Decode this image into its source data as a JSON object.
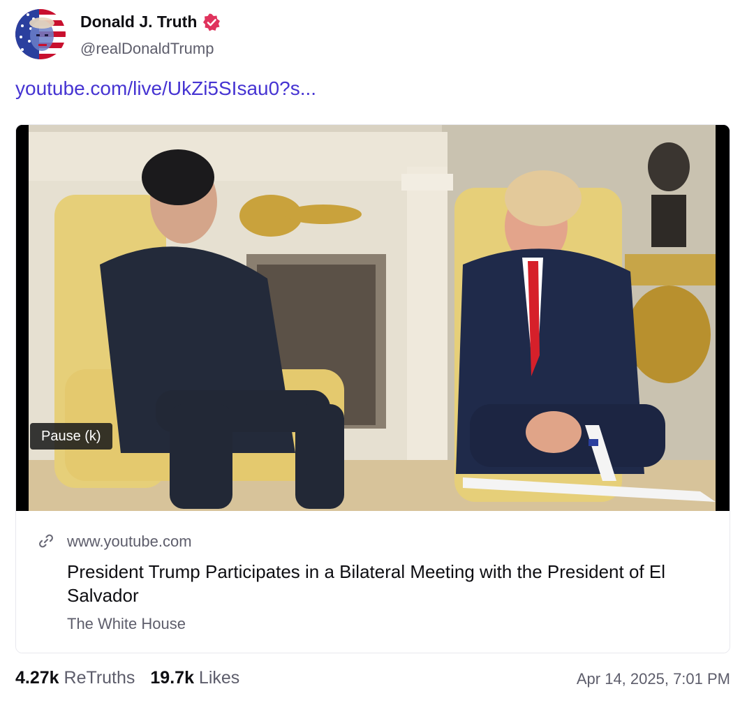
{
  "author": {
    "display_name": "Donald J. Truth",
    "handle": "@realDonaldTrump",
    "verified_icon": "verified-badge-icon",
    "verified_color": "#e0335d"
  },
  "post": {
    "link_text": "youtube.com/live/UkZi5SIsau0?s..."
  },
  "link_card": {
    "video_overlay": "Pause (k)",
    "domain": "www.youtube.com",
    "title": "President Trump Participates in a Bilateral Meeting with the President of El Salvador",
    "source": "The White House",
    "link_icon": "link-icon"
  },
  "stats": {
    "retruths_count": "4.27k",
    "retruths_label": "ReTruths",
    "likes_count": "19.7k",
    "likes_label": "Likes"
  },
  "timestamp": "Apr 14, 2025, 7:01 PM",
  "colors": {
    "link": "#4634d2",
    "muted_text": "#5d5d6b",
    "card_border": "#e8e8ee"
  }
}
